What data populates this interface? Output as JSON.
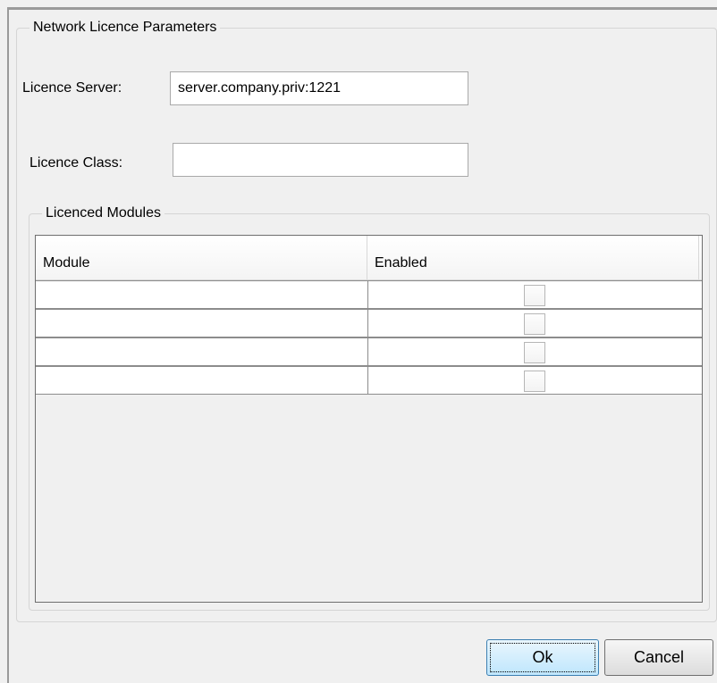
{
  "dialog": {
    "group_title": "Network Licence Parameters",
    "licence_server_label": "Licence Server:",
    "licence_server_value": "server.company.priv:1221",
    "licence_class_label": "Licence Class:",
    "licence_class_value": "",
    "modules_group_title": "Licenced Modules"
  },
  "table": {
    "columns": [
      "Module",
      "Enabled"
    ],
    "rows": [
      {
        "module": "",
        "enabled": false
      },
      {
        "module": "",
        "enabled": false
      },
      {
        "module": "",
        "enabled": false
      },
      {
        "module": "",
        "enabled": false
      }
    ]
  },
  "buttons": {
    "ok_label": "Ok",
    "cancel_label": "Cancel"
  }
}
